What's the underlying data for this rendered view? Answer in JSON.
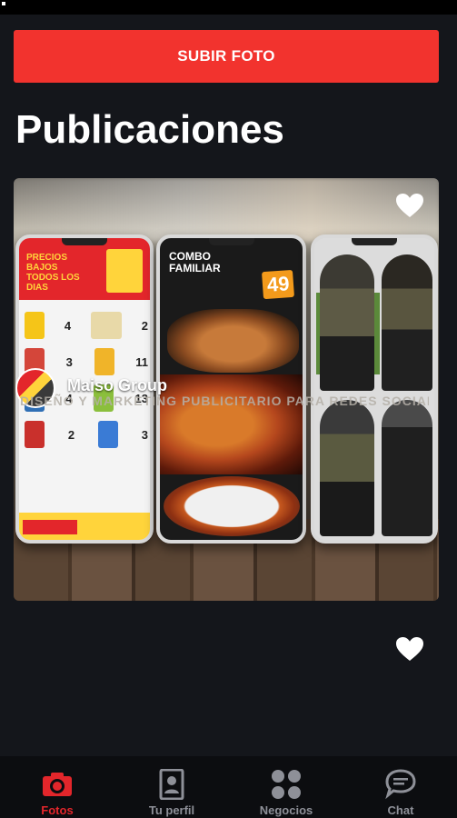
{
  "upload_button": {
    "label": "SUBIR FOTO"
  },
  "page": {
    "title": "Publicaciones"
  },
  "post": {
    "author": "Maiso Group",
    "caption": "DISEÑO Y MARKETING PUBLICITARIO PARA REDES SOCIALES",
    "flyer_left_headline": "PRECIOS BAJOS TODOS LOS DIAS",
    "flyer_left_prices": [
      "4",
      "2",
      "3",
      "11",
      "4",
      "13",
      "2",
      "3"
    ],
    "flyer_mid_title": "COMBO FAMILIAR",
    "flyer_mid_price": "49"
  },
  "nav": {
    "items": [
      {
        "label": "Fotos",
        "icon": "camera-icon",
        "active": true
      },
      {
        "label": "Tu perfil",
        "icon": "profile-icon",
        "active": false
      },
      {
        "label": "Negocios",
        "icon": "grid-icon",
        "active": false
      },
      {
        "label": "Chat",
        "icon": "chat-icon",
        "active": false
      }
    ]
  },
  "colors": {
    "accent": "#f2332e",
    "background": "#14161b",
    "nav_inactive": "#8e9098"
  }
}
